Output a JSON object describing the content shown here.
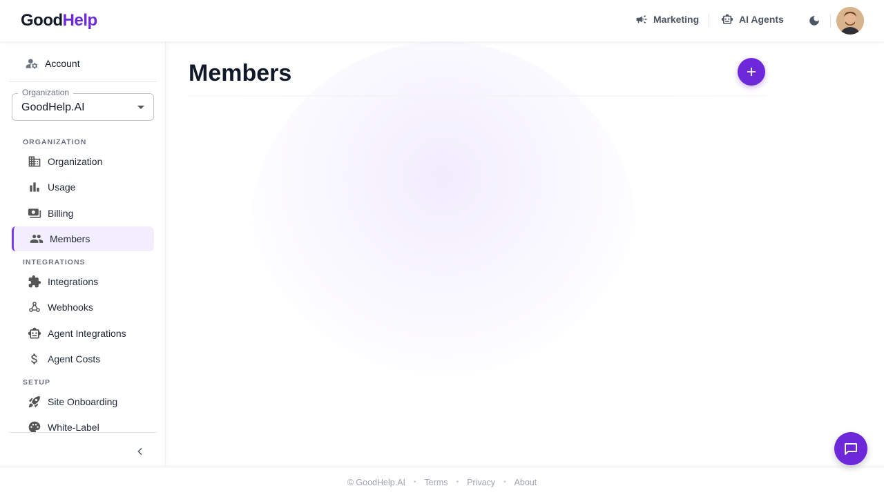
{
  "brand": {
    "part1": "Good",
    "part2": "Help"
  },
  "header": {
    "nav": [
      {
        "label": "Marketing",
        "icon": "megaphone-icon"
      },
      {
        "label": "AI Agents",
        "icon": "robot-icon"
      }
    ],
    "theme_icon": "moon-icon",
    "avatar": "user-avatar"
  },
  "sidebar": {
    "account_label": "Account",
    "org_select": {
      "legend": "Organization",
      "value": "GoodHelp.AI"
    },
    "sections": [
      {
        "title": "ORGANIZATION",
        "items": [
          {
            "label": "Organization",
            "icon": "building-icon"
          },
          {
            "label": "Usage",
            "icon": "bar-chart-icon"
          },
          {
            "label": "Billing",
            "icon": "billing-icon"
          },
          {
            "label": "Members",
            "icon": "people-icon",
            "active": true
          }
        ]
      },
      {
        "title": "INTEGRATIONS",
        "items": [
          {
            "label": "Integrations",
            "icon": "puzzle-icon"
          },
          {
            "label": "Webhooks",
            "icon": "webhook-icon"
          },
          {
            "label": "Agent Integrations",
            "icon": "robot-icon"
          },
          {
            "label": "Agent Costs",
            "icon": "dollar-icon"
          }
        ]
      },
      {
        "title": "SETUP",
        "items": [
          {
            "label": "Site Onboarding",
            "icon": "rocket-icon"
          },
          {
            "label": "White-Label",
            "icon": "palette-icon"
          }
        ]
      }
    ]
  },
  "main": {
    "title": "Members"
  },
  "footer": {
    "copyright": "© GoodHelp.AI",
    "links": [
      "Terms",
      "Privacy",
      "About"
    ]
  },
  "colors": {
    "brand": "#6d28d9",
    "active_bg": "#f3eefe"
  }
}
